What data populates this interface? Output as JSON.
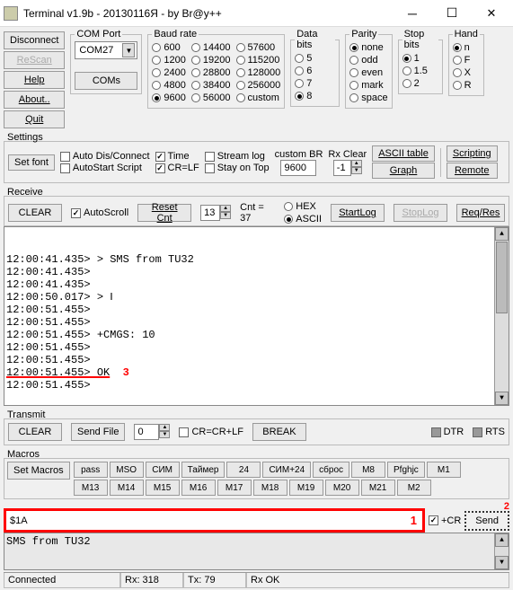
{
  "window": {
    "title": "Terminal v1.9b - 20130116Я - by Br@y++"
  },
  "sidebar_btns": {
    "disconnect": "Disconnect",
    "rescan": "ReScan",
    "help": "Help",
    "about": "About..",
    "quit": "Quit"
  },
  "comport": {
    "legend": "COM Port",
    "value": "COM27",
    "coms": "COMs"
  },
  "baud": {
    "legend": "Baud rate",
    "options": [
      [
        "600",
        "14400",
        "57600"
      ],
      [
        "1200",
        "19200",
        "115200"
      ],
      [
        "2400",
        "28800",
        "128000"
      ],
      [
        "4800",
        "38400",
        "256000"
      ],
      [
        "9600",
        "56000",
        "custom"
      ]
    ],
    "selected": "9600"
  },
  "databits": {
    "legend": "Data bits",
    "options": [
      "5",
      "6",
      "7",
      "8"
    ],
    "selected": "8"
  },
  "parity": {
    "legend": "Parity",
    "options": [
      "none",
      "odd",
      "even",
      "mark",
      "space"
    ],
    "selected": "none"
  },
  "stopbits": {
    "legend": "Stop bits",
    "options": [
      "1",
      "1.5",
      "2"
    ],
    "selected": "1"
  },
  "hand": {
    "legend": "Hand",
    "options": [
      "n",
      "F",
      "X",
      "R"
    ],
    "selected": "n"
  },
  "settings": {
    "legend": "Settings",
    "setfont": "Set font",
    "autodis": "Auto Dis/Connect",
    "autostart": "AutoStart Script",
    "time": "Time",
    "crlf": "CR=LF",
    "stream": "Stream log",
    "stayontop": "Stay on Top",
    "custombr": "custom BR",
    "custombr_val": "9600",
    "rxclear": "Rx Clear",
    "rxclear_val": "-1",
    "ascii": "ASCII table",
    "graph": "Graph",
    "scripting": "Scripting",
    "remote": "Remote"
  },
  "receive": {
    "legend": "Receive",
    "clear": "CLEAR",
    "autoscroll": "AutoScroll",
    "resetcnt": "Reset Cnt",
    "cntval": "13",
    "cnt_label": "Cnt = 37",
    "hex": "HEX",
    "ascii": "ASCII",
    "startlog": "StartLog",
    "stoplog": "StopLog",
    "reqres": "Req/Res"
  },
  "log_lines": [
    "12:00:41.435> > SMS from TU32",
    "12:00:41.435>",
    "12:00:41.435>",
    "12:00:50.017> > ‖",
    "12:00:51.455>",
    "12:00:51.455>",
    "12:00:51.455> +CMGS: 10",
    "12:00:51.455>",
    "12:00:51.455>"
  ],
  "log_ok_line": "12:00:51.455> OK",
  "log_ok_marker": "3",
  "log_tail": "12:00:51.455>",
  "transmit": {
    "legend": "Transmit",
    "clear": "CLEAR",
    "sendfile": "Send File",
    "spin": "0",
    "crcrlf": "CR=CR+LF",
    "break": "BREAK",
    "dtr": "DTR",
    "rts": "RTS"
  },
  "macros": {
    "legend": "Macros",
    "set": "Set Macros",
    "row1": [
      "pass",
      "MSO",
      "СИМ",
      "Таймер",
      "24",
      "СИМ+24",
      "сброс",
      "M8",
      "Pfghjc",
      "M1"
    ],
    "row2": [
      "M13",
      "M14",
      "M15",
      "M16",
      "M17",
      "M18",
      "M19",
      "M20",
      "M21",
      "M2"
    ]
  },
  "send": {
    "value": "$1A",
    "num": "1",
    "cr": "+CR",
    "btn": "Send",
    "marker2": "2"
  },
  "bottom": {
    "text": "SMS from TU32"
  },
  "status": {
    "conn": "Connected",
    "rx": "Rx: 318",
    "tx": "Tx: 79",
    "rxok": "Rx OK"
  }
}
